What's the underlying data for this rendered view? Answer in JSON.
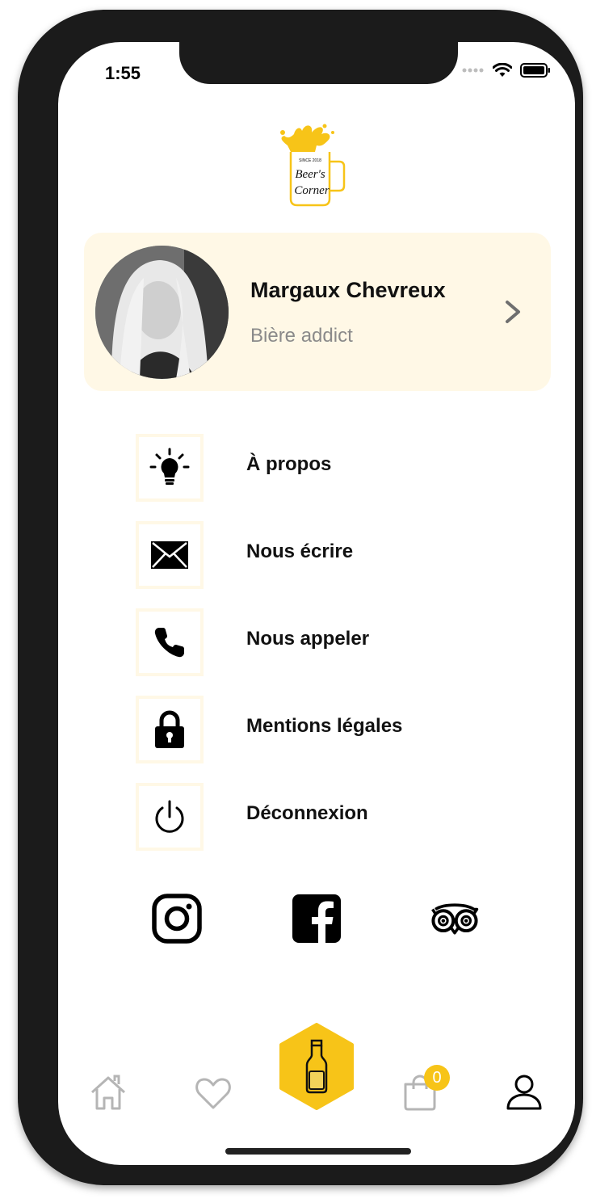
{
  "status_bar": {
    "time": "1:55"
  },
  "logo": {
    "line1": "Beer's",
    "line2": "Corner",
    "since": "SINCE 2018"
  },
  "profile": {
    "name": "Margaux Chevreux",
    "subtitle": "Bière addict"
  },
  "menu": [
    {
      "label": "À propos",
      "icon": "lightbulb-icon"
    },
    {
      "label": "Nous écrire",
      "icon": "envelope-icon"
    },
    {
      "label": "Nous appeler",
      "icon": "phone-icon"
    },
    {
      "label": "Mentions légales",
      "icon": "lock-icon"
    },
    {
      "label": "Déconnexion",
      "icon": "power-icon"
    }
  ],
  "social": [
    "instagram-icon",
    "facebook-icon",
    "tripadvisor-icon"
  ],
  "bottom_nav": {
    "items": [
      "home-icon",
      "heart-icon",
      "beer-bottle-icon",
      "cart-icon",
      "user-icon"
    ],
    "cart_count": "0",
    "active": "user-icon"
  },
  "colors": {
    "accent": "#f7c418",
    "card_bg": "#fff8e6",
    "text": "#111111",
    "muted": "#8a8a8a"
  }
}
